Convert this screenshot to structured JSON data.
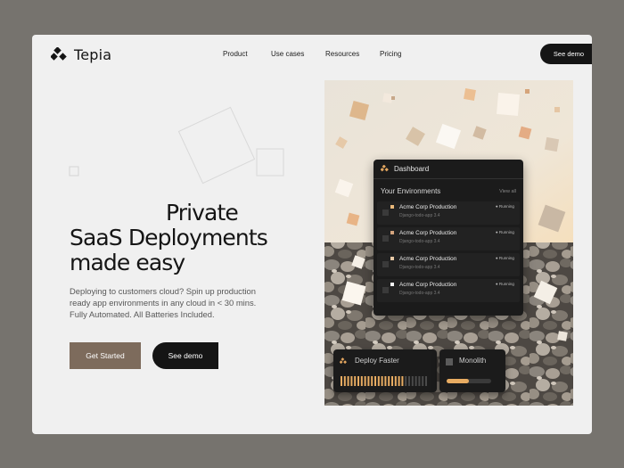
{
  "brand": {
    "name": "Tepia",
    "accent": "#7d6b5c",
    "dark": "#151515"
  },
  "nav": {
    "items": [
      "Product",
      "Use cases",
      "Resources",
      "Pricing"
    ],
    "cta": "See demo"
  },
  "hero": {
    "title_line1": "Private",
    "title_line2": "SaaS Deployments",
    "title_line3": "made easy",
    "subtitle": "Deploying to customers cloud? Spin up production ready app environments in any cloud in < 30 mins. Fully Automated. All Batteries Included.",
    "primary_cta": "Get Started",
    "secondary_cta": "See demo"
  },
  "dashboard": {
    "title": "Dashboard",
    "section": "Your Environments",
    "view_all": "View all",
    "environments": [
      {
        "name": "Acme Corp Production",
        "sub": "Django-todo-app 3.4",
        "status": "Running",
        "dot": "#e9b87a"
      },
      {
        "name": "Acme Corp Production",
        "sub": "Django-todo-app 3.4",
        "status": "Running",
        "dot": "#d4a57e"
      },
      {
        "name": "Acme Corp Production",
        "sub": "Django-todo-app 3.4",
        "status": "Running",
        "dot": "#e7c9a6"
      },
      {
        "name": "Acme Corp Production",
        "sub": "Django-todo-app 3.4",
        "status": "Running",
        "dot": "#f4f4f4"
      }
    ]
  },
  "widgets": {
    "deploy": {
      "label": "Deploy Faster",
      "progress": 0.72
    },
    "monolith": {
      "label": "Monolith",
      "progress": 0.5
    }
  }
}
